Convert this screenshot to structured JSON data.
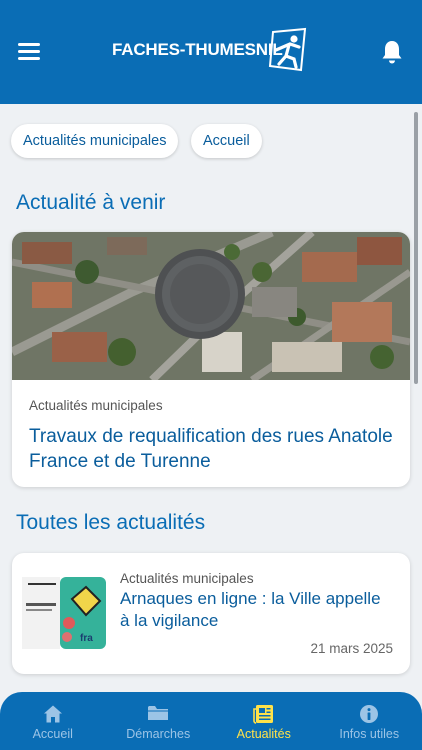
{
  "header": {
    "logo_text": "FACHES-THUMESNIL",
    "menu_icon": "hamburger-menu-icon",
    "notification_icon": "bell-icon"
  },
  "filters": {
    "chips": [
      {
        "label": "Actualités municipales"
      },
      {
        "label": "Accueil"
      }
    ]
  },
  "upcoming": {
    "section_title": "Actualité à venir",
    "card": {
      "category": "Actualités municipales",
      "title": "Travaux de requalification des rues Anatole France et de Turenne"
    }
  },
  "all_news": {
    "section_title": "Toutes les actualités",
    "items": [
      {
        "category": "Actualités municipales",
        "title": "Arnaques en ligne : la Ville appelle à la vigilance",
        "date": "21 mars 2025"
      }
    ]
  },
  "tabbar": {
    "active_tab": "Actualités",
    "tabs": [
      {
        "label": "Accueil",
        "icon": "home-icon"
      },
      {
        "label": "Démarches",
        "icon": "folder-icon"
      },
      {
        "label": "Actualités",
        "icon": "newspaper-icon"
      },
      {
        "label": "Infos utiles",
        "icon": "info-icon"
      }
    ]
  },
  "colors": {
    "brand_blue": "#0a6db5",
    "active_tab": "#ffe24a",
    "inactive_tab": "#9cc4e6",
    "background": "#eef1f4"
  }
}
